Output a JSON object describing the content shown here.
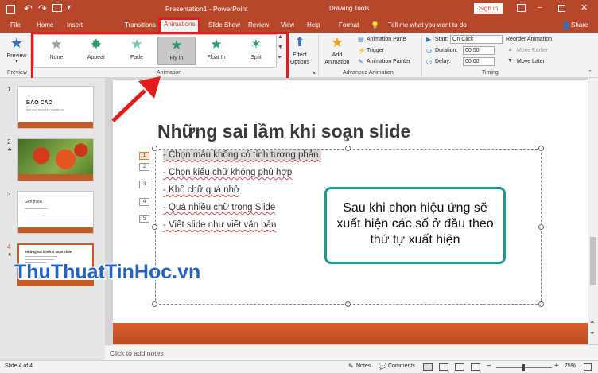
{
  "window": {
    "title": "Presentation1 - PowerPoint",
    "drawing_tools": "Drawing Tools",
    "sign_in": "Sign in"
  },
  "tabs": {
    "file": "File",
    "home": "Home",
    "insert": "Insert",
    "transitions": "Transitions",
    "animations": "Animations",
    "slide_show": "Slide Show",
    "review": "Review",
    "view": "View",
    "help": "Help",
    "format": "Format",
    "tell_me": "Tell me what you want to do",
    "share": "Share"
  },
  "ribbon": {
    "preview": "Preview",
    "preview_group": "Preview",
    "animation_group": "Animation",
    "animations": [
      "None",
      "Appear",
      "Fade",
      "Fly In",
      "Float In",
      "Split"
    ],
    "effect_options": "Effect Options",
    "add_animation": "Add Animation",
    "animation_pane": "Animation Pane",
    "trigger": "Trigger",
    "animation_painter": "Animation Painter",
    "advanced_group": "Advanced Animation",
    "start_label": "Start:",
    "start_value": "On Click",
    "duration_label": "Duration:",
    "duration_value": "00.50",
    "delay_label": "Delay:",
    "delay_value": "00.00",
    "reorder_title": "Reorder Animation",
    "move_earlier": "Move Earlier",
    "move_later": "Move Later",
    "timing_group": "Timing"
  },
  "thumbnails": {
    "nums": [
      "1",
      "2",
      "3",
      "4"
    ],
    "slide1_title": "BÁO CÁO",
    "slide1_sub": "BÁO CÁO THỰC TẬP NGHIỆP VỤ",
    "slide3_title": "Giới thiệu",
    "slide4_title": "Những sai lầm khi soạn slide"
  },
  "slide": {
    "title": "Những sai lầm khi soạn slide",
    "bullets": [
      "- Chọn màu không có tính tương phản.",
      "- Chọn kiểu chữ không phủ hợp",
      "- Khổ chữ quá nhỏ",
      "- Quá nhiều chữ trong Slide",
      "- Viết slide như viết văn bản"
    ],
    "numbers": [
      "1",
      "2",
      "3",
      "4",
      "5"
    ],
    "callout": "Sau khi chọn hiệu ứng sẽ xuất hiện các số ở đầu theo thứ tự xuất hiện"
  },
  "watermark": "ThuThuatTinHoc.vn",
  "notes_placeholder": "Click to add notes",
  "status": {
    "slide_info": "Slide 4 of 4",
    "notes": "Notes",
    "comments": "Comments",
    "zoom": "75%"
  },
  "colors": {
    "accent": "#b7472a",
    "highlight": "#e31b1b",
    "callout_border": "#1e9a8a"
  }
}
